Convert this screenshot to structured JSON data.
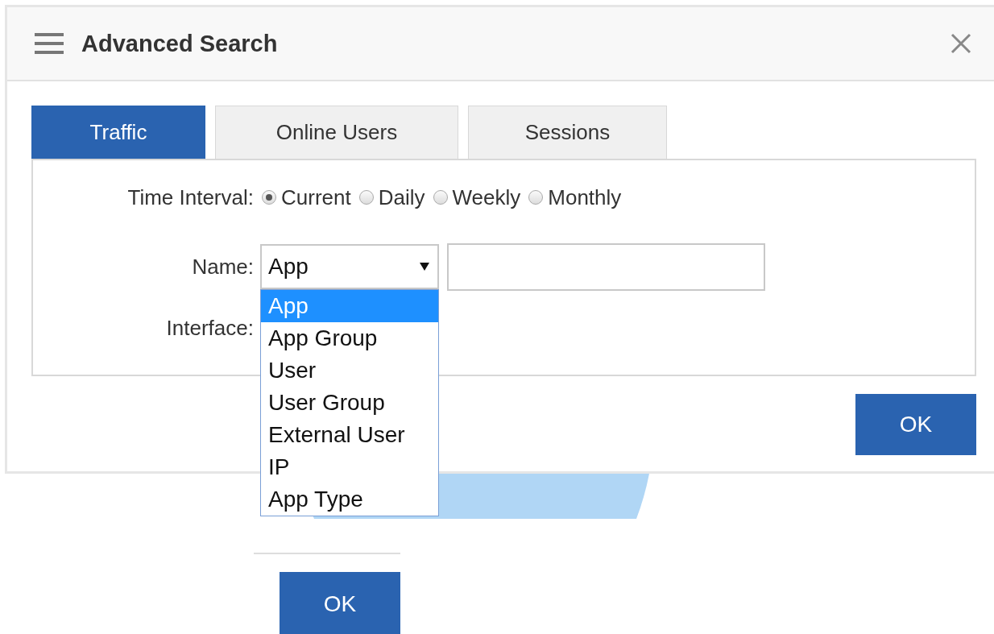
{
  "dialog": {
    "title": "Advanced Search",
    "tabs": [
      {
        "label": "Traffic",
        "selected": true
      },
      {
        "label": "Online Users",
        "selected": false
      },
      {
        "label": "Sessions",
        "selected": false
      }
    ],
    "time_interval": {
      "label": "Time Interval:",
      "options": [
        {
          "label": "Current",
          "selected": true
        },
        {
          "label": "Daily",
          "selected": false
        },
        {
          "label": "Weekly",
          "selected": false
        },
        {
          "label": "Monthly",
          "selected": false
        }
      ]
    },
    "name": {
      "label": "Name:",
      "select_value": "App",
      "expanded": true,
      "options": [
        {
          "label": "App",
          "selected": true
        },
        {
          "label": "App Group",
          "selected": false
        },
        {
          "label": "User",
          "selected": false
        },
        {
          "label": "User Group",
          "selected": false
        },
        {
          "label": "External User",
          "selected": false
        },
        {
          "label": "IP",
          "selected": false
        },
        {
          "label": "App Type",
          "selected": false
        }
      ]
    },
    "interface": {
      "label": "Interface:"
    },
    "ok_button": "OK"
  },
  "background": {
    "ok_button": "OK"
  }
}
